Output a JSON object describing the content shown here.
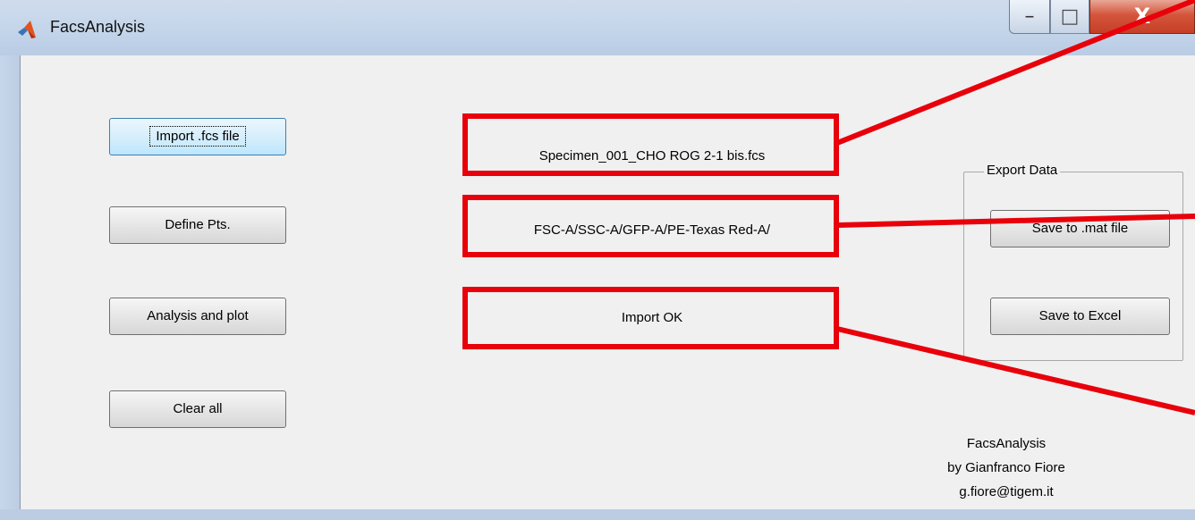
{
  "window": {
    "title": "FacsAnalysis",
    "minimize_glyph": "–",
    "maximize_glyph": "□",
    "close_glyph": "X"
  },
  "buttons": {
    "import_label": "Import .fcs file",
    "define_pts_label": "Define Pts.",
    "analysis_label": "Analysis and plot",
    "clear_label": "Clear all"
  },
  "fields": {
    "filename": "Specimen_001_CHO ROG 2-1  bis.fcs",
    "channels": "FSC-A/SSC-A/GFP-A/PE-Texas Red-A/",
    "status": "Import OK"
  },
  "export": {
    "group_title": "Export Data",
    "save_mat_label": "Save to .mat file",
    "save_excel_label": "Save to Excel"
  },
  "credits": {
    "app_name": "FacsAnalysis",
    "author": "by Gianfranco Fiore",
    "email": "g.fiore@tigem.it"
  },
  "colors": {
    "highlight": "#e8000b",
    "titlebar": "#c4d5ea",
    "close_button": "#c53f26"
  },
  "icons": [
    "matlab-icon",
    "minimize-icon",
    "maximize-icon",
    "close-icon"
  ]
}
